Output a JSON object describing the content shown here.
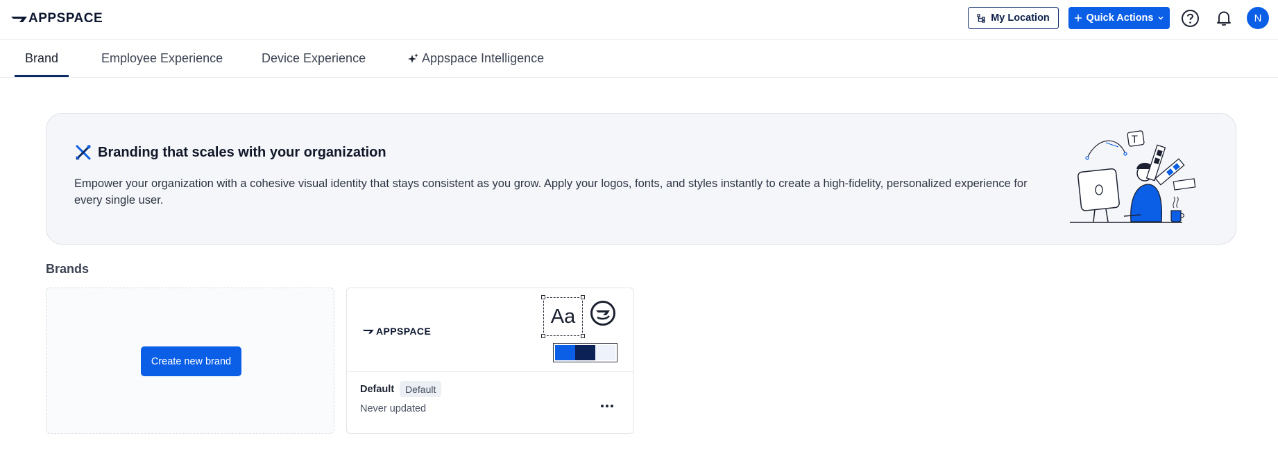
{
  "header": {
    "logo_text": "APPSPACE",
    "my_location_label": "My Location",
    "quick_actions_label": "Quick Actions",
    "avatar_initial": "N"
  },
  "tabs": [
    {
      "label": "Brand",
      "active": true
    },
    {
      "label": "Employee Experience",
      "active": false
    },
    {
      "label": "Device Experience",
      "active": false
    },
    {
      "label": "Appspace Intelligence",
      "active": false
    }
  ],
  "banner": {
    "title": "Branding that scales with your organization",
    "description": "Empower your organization with a cohesive visual identity that stays consistent as you grow. Apply your logos, fonts, and styles instantly to create a high-fidelity, personalized experience for every single user."
  },
  "brands": {
    "section_title": "Brands",
    "create_label": "Create new brand",
    "items": [
      {
        "logo_text": "APPSPACE",
        "font_sample": "Aa",
        "name": "Default",
        "badge": "Default",
        "updated": "Never updated",
        "swatches": [
          "#0b5ee6",
          "#0c2156",
          "#eef2fb"
        ]
      }
    ]
  },
  "colors": {
    "primary": "#0b5ee6",
    "navy": "#0d2a66"
  }
}
